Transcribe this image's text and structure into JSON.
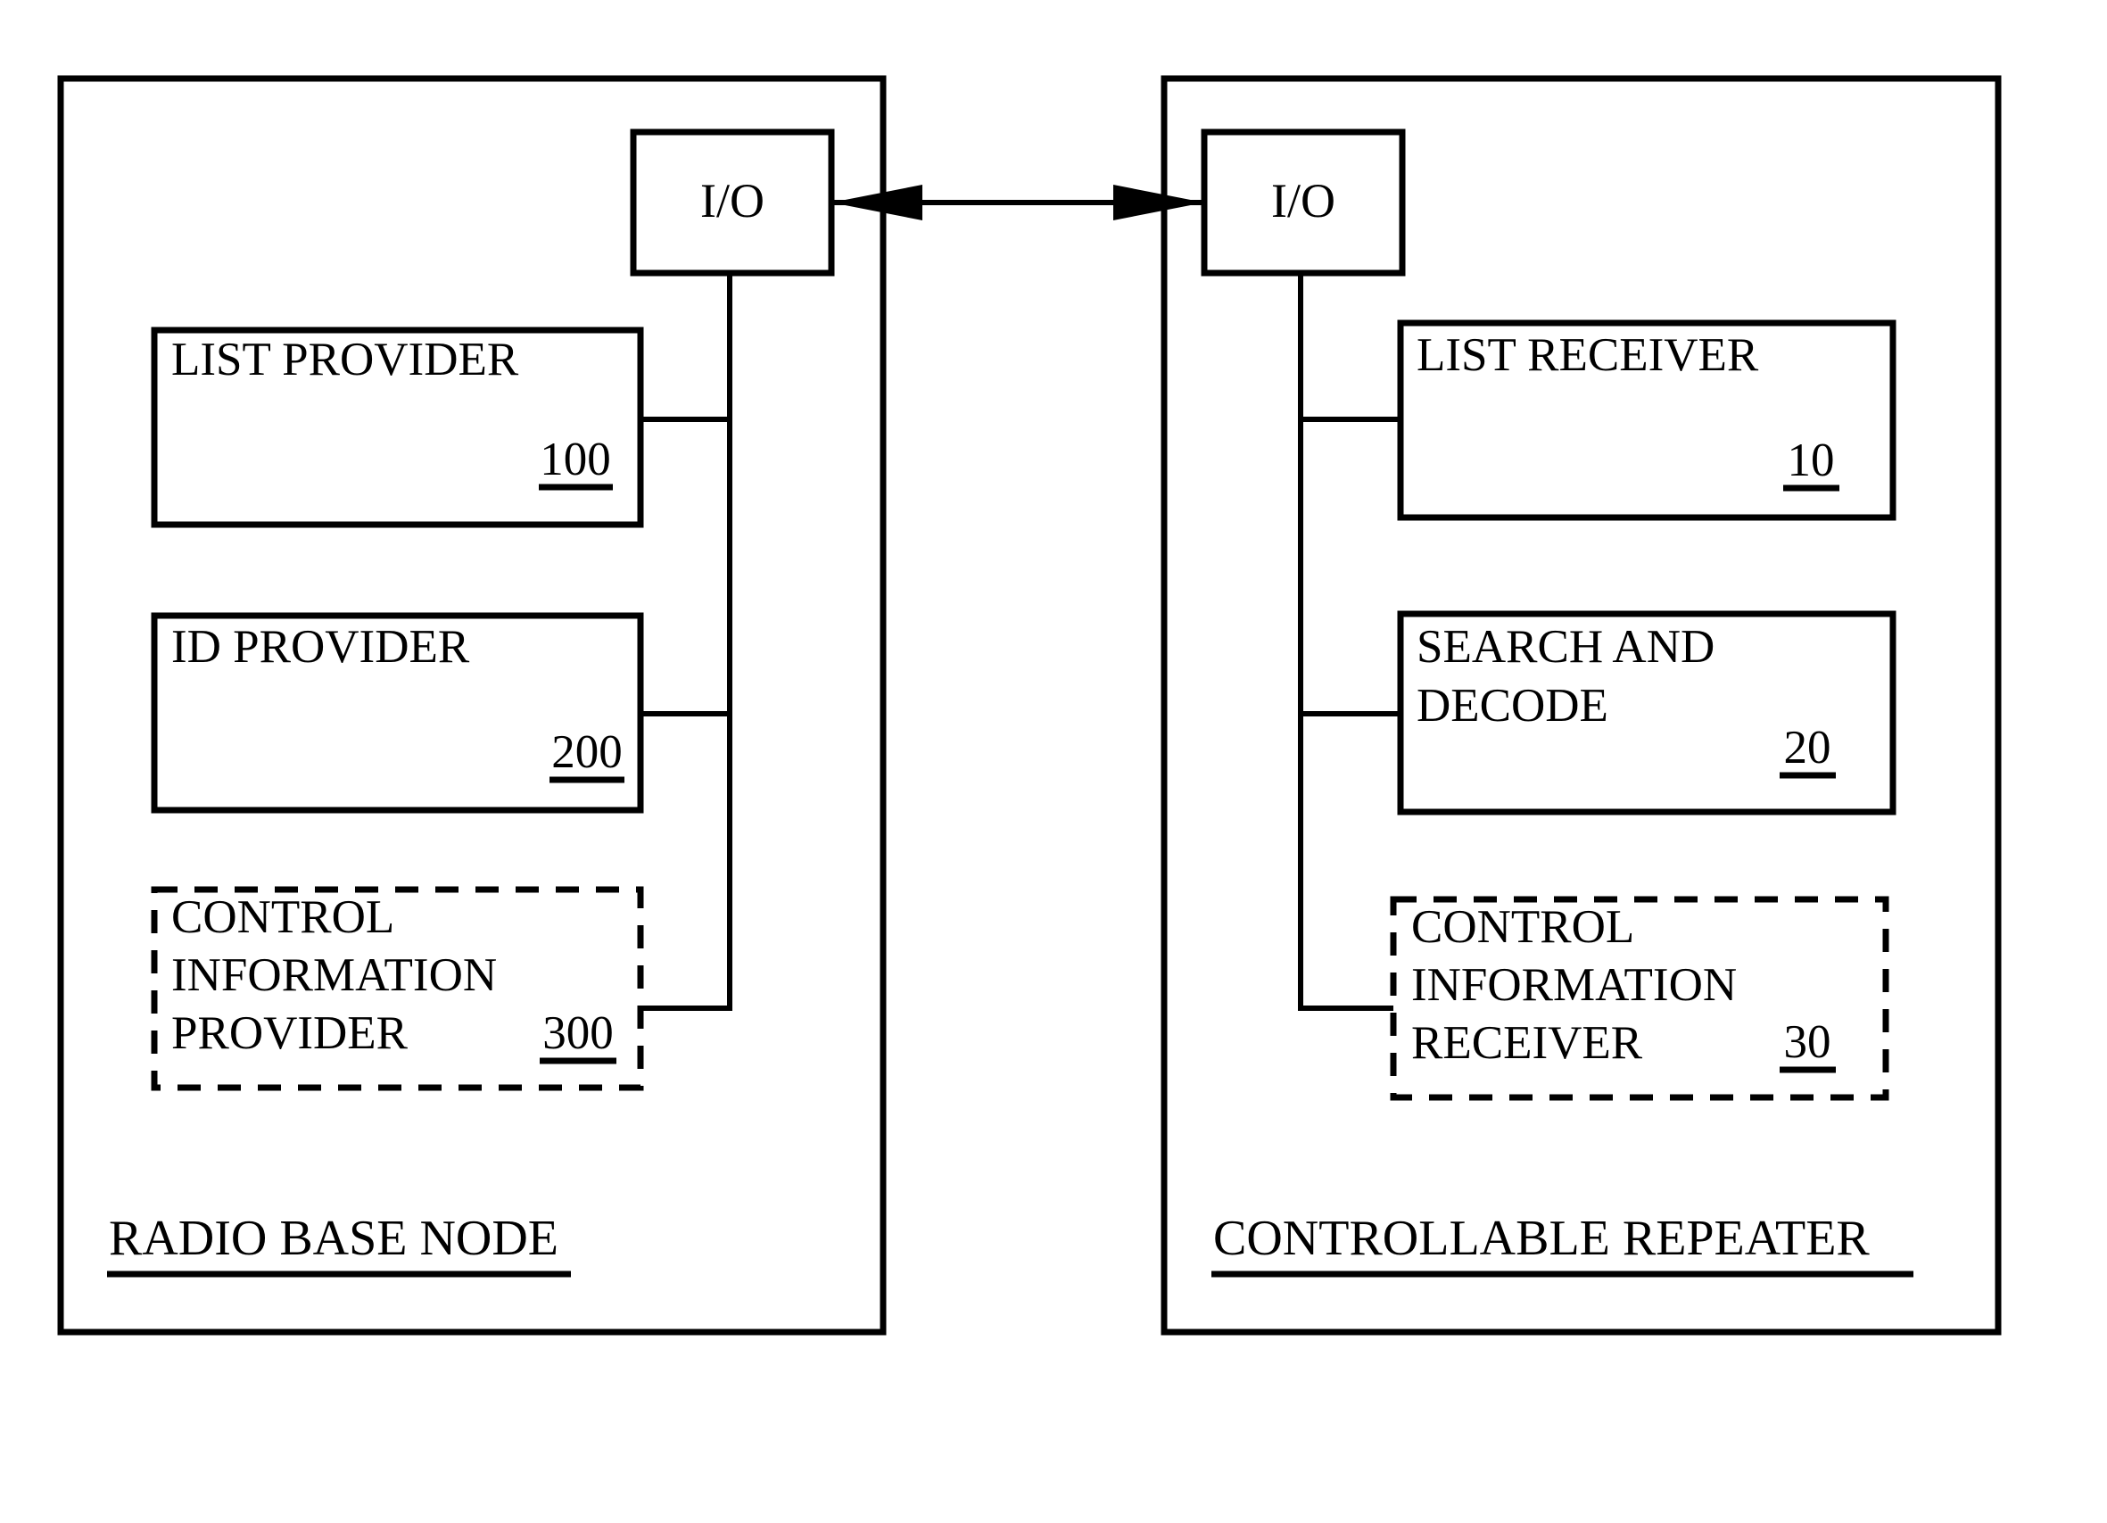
{
  "figure": {
    "background_color": "#ffffff",
    "line_color": "#000000"
  },
  "left_panel": {
    "label": "RADIO BASE NODE",
    "io": {
      "label": "I/O"
    },
    "blocks": [
      {
        "lines": [
          "LIST PROVIDER"
        ],
        "ref": "100",
        "style": "solid"
      },
      {
        "lines": [
          "ID PROVIDER"
        ],
        "ref": "200",
        "style": "solid"
      },
      {
        "lines": [
          "CONTROL",
          "INFORMATION",
          "PROVIDER"
        ],
        "ref": "300",
        "style": "dashed"
      }
    ]
  },
  "right_panel": {
    "label": "CONTROLLABLE REPEATER",
    "io": {
      "label": "I/O"
    },
    "blocks": [
      {
        "lines": [
          "LIST RECEIVER"
        ],
        "ref": "10",
        "style": "solid"
      },
      {
        "lines": [
          "SEARCH AND",
          "DECODE"
        ],
        "ref": "20",
        "style": "solid"
      },
      {
        "lines": [
          "CONTROL",
          "INFORMATION",
          "RECEIVER"
        ],
        "ref": "30",
        "style": "dashed"
      }
    ]
  },
  "connector": {
    "type": "bidirectional-arrow",
    "from": "left-io",
    "to": "right-io"
  }
}
